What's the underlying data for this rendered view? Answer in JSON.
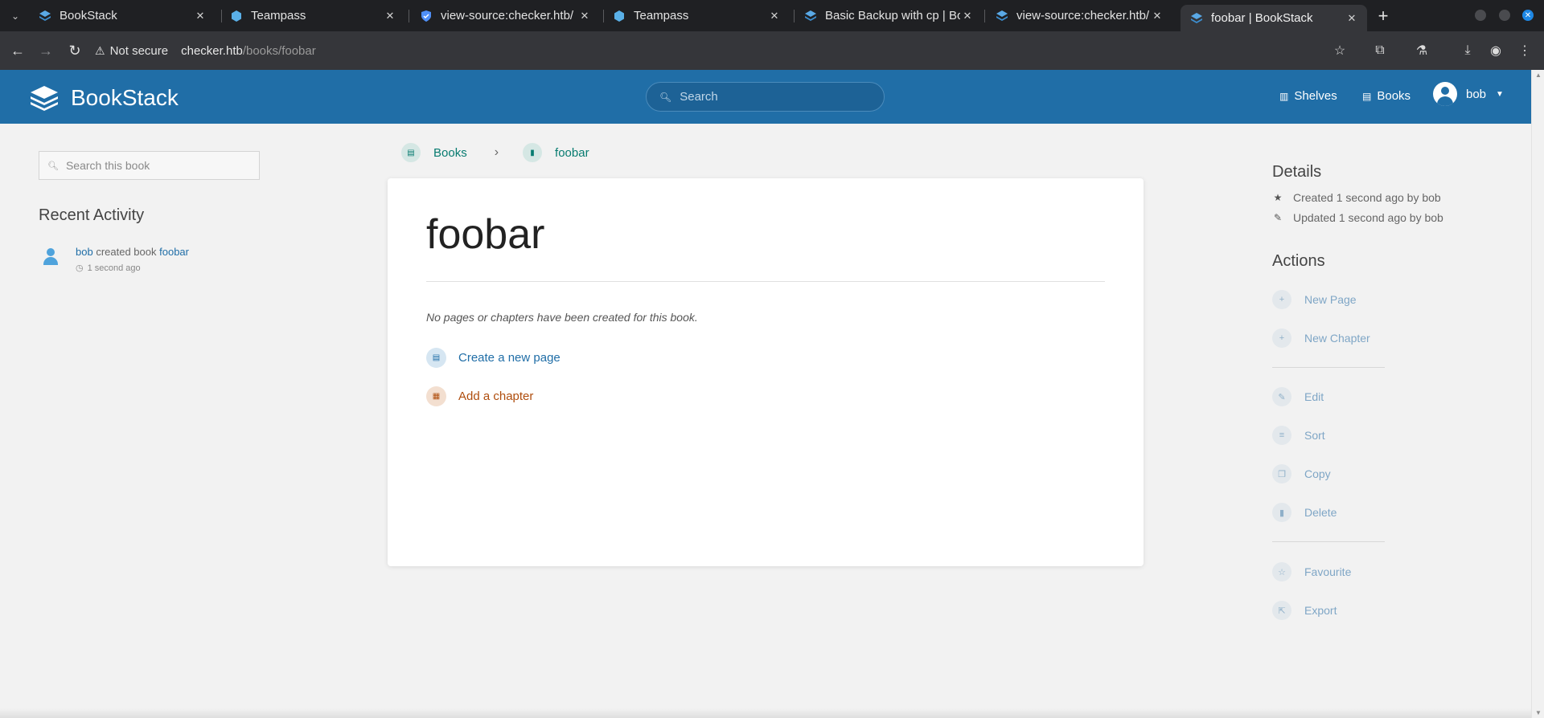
{
  "browser": {
    "tabs": [
      {
        "title": "BookStack",
        "active": false
      },
      {
        "title": "Teampass",
        "active": false
      },
      {
        "title": "view-source:checker.htb/",
        "active": false
      },
      {
        "title": "Teampass",
        "active": false
      },
      {
        "title": "Basic Backup with cp | Bo",
        "active": false
      },
      {
        "title": "view-source:checker.htb/",
        "active": false
      },
      {
        "title": "foobar | BookStack",
        "active": true
      }
    ],
    "security_label": "Not secure",
    "url_host": "checker.htb",
    "url_path": "/books/foobar"
  },
  "header": {
    "app_name": "BookStack",
    "search_placeholder": "Search",
    "nav": [
      {
        "label": "Shelves",
        "icon": "shelves-icon"
      },
      {
        "label": "Books",
        "icon": "books-icon"
      }
    ],
    "user_name": "bob"
  },
  "left": {
    "book_search_placeholder": "Search this book",
    "recent_activity_heading": "Recent Activity",
    "activity": [
      {
        "user": "bob",
        "action": "created book",
        "target": "foobar",
        "time": "1 second ago"
      }
    ]
  },
  "breadcrumb": [
    {
      "label": "Books"
    },
    {
      "label": "foobar"
    }
  ],
  "book": {
    "title": "foobar",
    "empty_message": "No pages or chapters have been created for this book.",
    "create_page_label": "Create a new page",
    "add_chapter_label": "Add a chapter"
  },
  "details": {
    "heading": "Details",
    "created": "Created 1 second ago by bob",
    "updated": "Updated 1 second ago by bob"
  },
  "actions": {
    "heading": "Actions",
    "items": [
      {
        "label": "New Page",
        "icon": "plus-icon"
      },
      {
        "label": "New Chapter",
        "icon": "plus-icon"
      },
      {
        "label": "Edit",
        "icon": "pencil-icon"
      },
      {
        "label": "Sort",
        "icon": "sort-icon"
      },
      {
        "label": "Copy",
        "icon": "copy-icon"
      },
      {
        "label": "Delete",
        "icon": "trash-icon"
      },
      {
        "label": "Favourite",
        "icon": "star-icon"
      },
      {
        "label": "Export",
        "icon": "export-icon"
      }
    ]
  },
  "colors": {
    "header": "#206ea7",
    "page_bg": "#f2f2f2",
    "book_accent": "#077b70",
    "page_link": "#206ea7",
    "chapter_link": "#af4d0d"
  }
}
